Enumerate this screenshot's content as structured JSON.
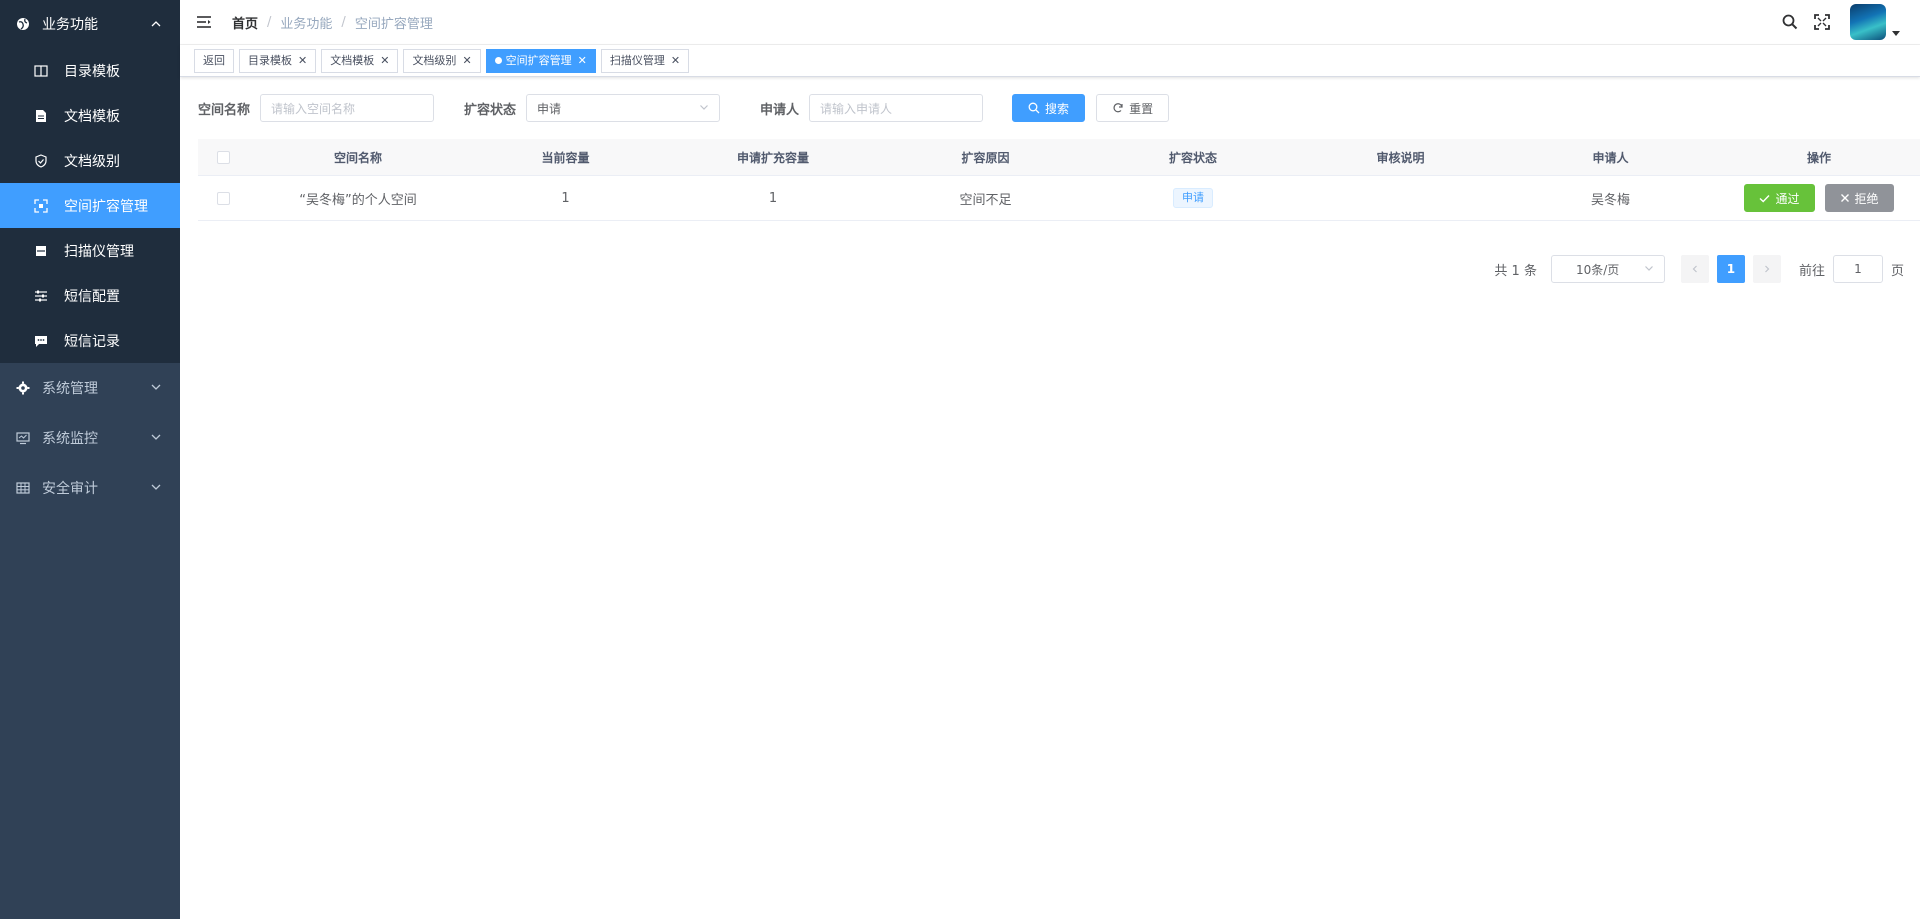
{
  "sidebar": {
    "group_business": "业务功能",
    "items": [
      {
        "label": "目录模板",
        "icon": "book-icon"
      },
      {
        "label": "文档模板",
        "icon": "document-icon"
      },
      {
        "label": "文档级别",
        "icon": "shield-icon"
      },
      {
        "label": "空间扩容管理",
        "icon": "expand-icon"
      },
      {
        "label": "扫描仪管理",
        "icon": "scanner-icon"
      },
      {
        "label": "短信配置",
        "icon": "sliders-icon"
      },
      {
        "label": "短信记录",
        "icon": "message-icon"
      }
    ],
    "group_system": "系统管理",
    "group_monitor": "系统监控",
    "group_audit": "安全审计"
  },
  "breadcrumb": {
    "home": "首页",
    "level1": "业务功能",
    "level2": "空间扩容管理"
  },
  "tags": [
    {
      "label": "返回"
    },
    {
      "label": "目录模板"
    },
    {
      "label": "文档模板"
    },
    {
      "label": "文档级别"
    },
    {
      "label": "空间扩容管理"
    },
    {
      "label": "扫描仪管理"
    }
  ],
  "search": {
    "space_label": "空间名称",
    "space_placeholder": "请输入空间名称",
    "status_label": "扩容状态",
    "status_value": "申请",
    "applicant_label": "申请人",
    "applicant_placeholder": "请输入申请人",
    "search_btn": "搜索",
    "reset_btn": "重置"
  },
  "table": {
    "headers": [
      "空间名称",
      "当前容量",
      "申请扩充容量",
      "扩容原因",
      "扩容状态",
      "审核说明",
      "申请人",
      "操作"
    ],
    "rows": [
      {
        "space_name": "“吴冬梅”的个人空间",
        "current_capacity": "1",
        "requested_capacity": "1",
        "reason": "空间不足",
        "status": "申请",
        "review_note": "",
        "applicant": "吴冬梅",
        "approve_btn": "通过",
        "reject_btn": "拒绝"
      }
    ]
  },
  "pagination": {
    "total": "共 1 条",
    "page_size": "10条/页",
    "current_page": "1",
    "goto_label": "前往",
    "goto_value": "1",
    "page_unit": "页"
  },
  "colors": {
    "sidebar_bg": "#304156",
    "sidebar_open_bg": "#1f2d3d",
    "primary": "#409eff",
    "success": "#67c23a",
    "info": "#909399"
  }
}
